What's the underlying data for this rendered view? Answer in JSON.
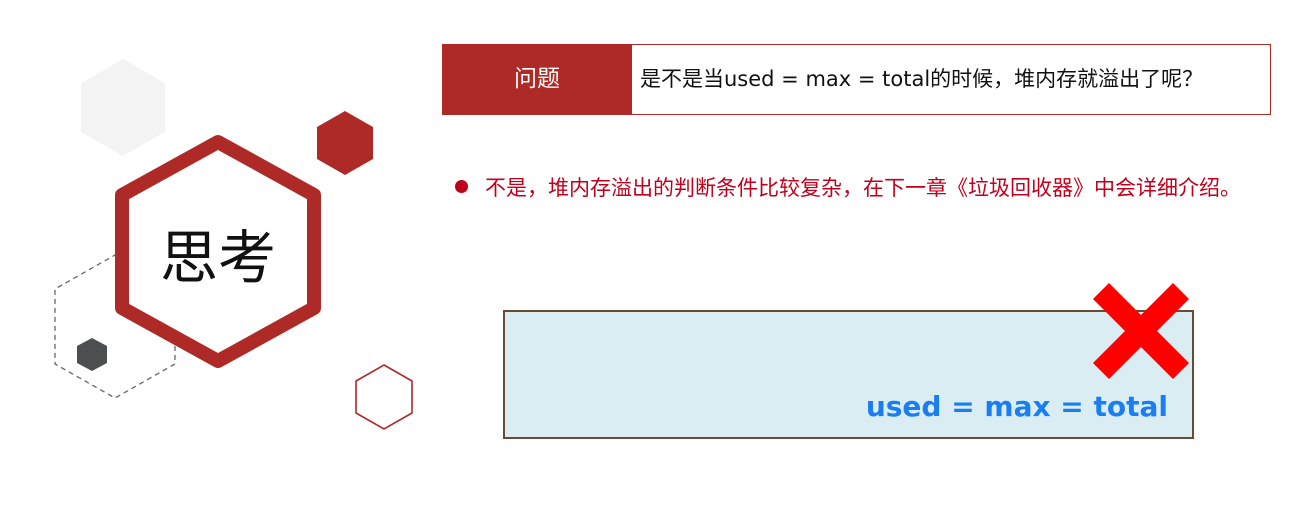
{
  "think_label": "思考",
  "question": {
    "label": "问题",
    "text": "是不是当used = max = total的时候，堆内存就溢出了呢？"
  },
  "answer": {
    "text": "不是，堆内存溢出的判断条件比较复杂，在下一章《垃圾回收器》中会详细介绍。"
  },
  "memory_box": {
    "label": "used = max = total"
  },
  "colors": {
    "brand_red": "#ad2a27",
    "answer_red": "#c0001c",
    "box_fill": "#daedf3",
    "box_border": "#6b4a33",
    "label_blue": "#1a7ef2",
    "cross_red": "#ff0000",
    "dark_gray": "#4b4f4f",
    "light_gray": "#f3f3f3"
  },
  "icons": {
    "cross": "red-x-cross-icon"
  }
}
